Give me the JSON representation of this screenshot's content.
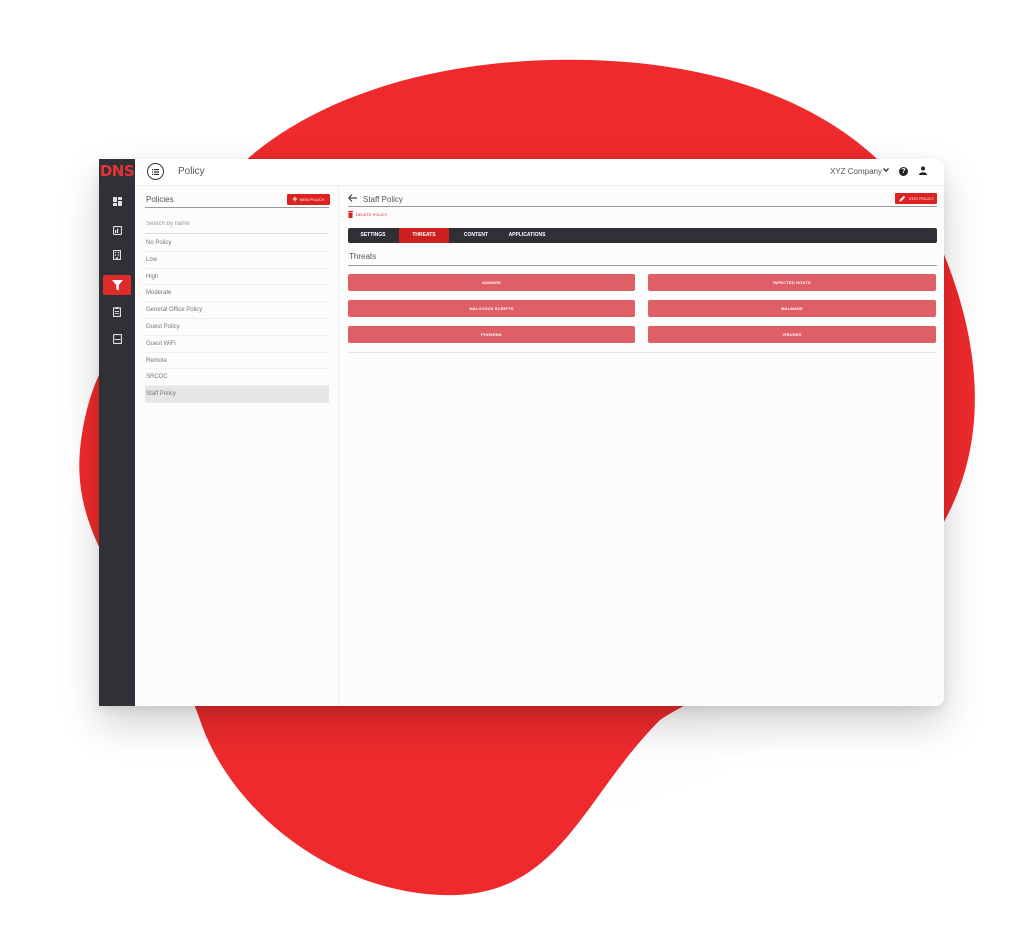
{
  "app": {
    "logo": "DNS",
    "page_title": "Policy",
    "company": "XYZ Company"
  },
  "rail": {
    "items": [
      {
        "icon": "dashboard-icon"
      },
      {
        "icon": "reports-icon"
      },
      {
        "icon": "building-icon"
      },
      {
        "icon": "filter-icon",
        "active": true
      },
      {
        "icon": "clipboard-icon"
      },
      {
        "icon": "server-icon"
      }
    ],
    "colors": {
      "background": "#2f3136",
      "active": "#e02b2b"
    }
  },
  "policies": {
    "title": "Policies",
    "new_label": "NEW POLICY",
    "search_placeholder": "Search by name",
    "items": [
      {
        "label": "No Policy"
      },
      {
        "label": "Low"
      },
      {
        "label": "High"
      },
      {
        "label": "Moderate"
      },
      {
        "label": "General Office Policy"
      },
      {
        "label": "Guest Policy"
      },
      {
        "label": "Guest WiFi"
      },
      {
        "label": "Remote"
      },
      {
        "label": "SRCOC"
      },
      {
        "label": "Staff Policy",
        "selected": true
      }
    ]
  },
  "detail": {
    "title": "Staff Policy",
    "edit_label": "EDIT POLICY",
    "delete_label": "DELETE POLICY",
    "tabs": [
      {
        "label": "SETTINGS"
      },
      {
        "label": "THREATS",
        "active": true
      },
      {
        "label": "CONTENT"
      },
      {
        "label": "APPLICATIONS"
      }
    ],
    "section_title": "Threats",
    "threats": [
      {
        "label": "ADWARE"
      },
      {
        "label": "INFECTED HOSTS"
      },
      {
        "label": "MALICIOUS SCRIPTS"
      },
      {
        "label": "MALWARE"
      },
      {
        "label": "PHISHING"
      },
      {
        "label": "VIRUSES"
      }
    ]
  },
  "colors": {
    "accent": "#dd2222",
    "threat_button": "#de5f66",
    "blob": "#ee2a2c"
  }
}
